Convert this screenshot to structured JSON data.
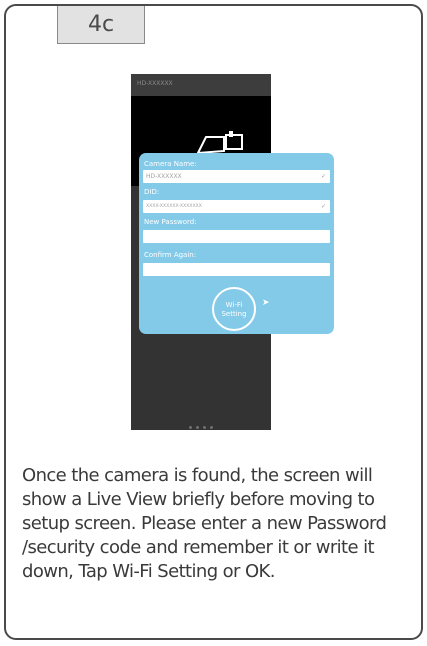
{
  "step": {
    "label": "4c"
  },
  "phone": {
    "title": "HD-XXXXXX",
    "page_dots": 4
  },
  "form": {
    "camera_name": {
      "label": "Camera Name:",
      "value": "HD-XXXXXX"
    },
    "did": {
      "label": "DID:",
      "value": "XXXX-XXXXXX-XXXXXXX"
    },
    "new_password": {
      "label": "New Password:",
      "value": ""
    },
    "confirm_again": {
      "label": "Confirm Again:",
      "value": ""
    },
    "wifi_button": {
      "line1": "Wi-Fi",
      "line2": "Setting"
    }
  },
  "description": "Once the camera is found, the screen will show a Live View briefly before moving to setup screen. Please enter a new Password /security code and remember it or write it down, Tap Wi-Fi Setting or OK.",
  "colors": {
    "dialog": "#83c9e8",
    "border": "#4a4a4a",
    "phone_bg": "#333334"
  }
}
